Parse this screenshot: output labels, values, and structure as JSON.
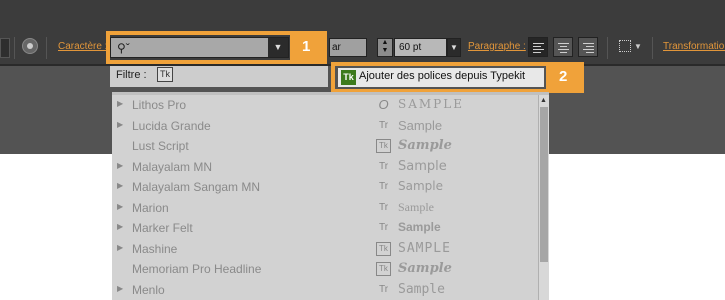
{
  "toolbar": {
    "character_label": "Caractère :",
    "font_search_placeholder": "",
    "style_value": "ar",
    "size_value": "60 pt",
    "paragraph_label": "Paragraphe :",
    "transform_label": "Transformation"
  },
  "callouts": {
    "one": "1",
    "two": "2"
  },
  "filter": {
    "label": "Filtre :",
    "typekit_icon": "Tk"
  },
  "typekit_button": {
    "icon": "Tk",
    "label": "Ajouter des polices depuis Typekit"
  },
  "font_list": [
    {
      "name": "Lithos Pro",
      "expandable": true,
      "type_icon": "O",
      "type": "opentype-icon",
      "sample": "SAMPLE"
    },
    {
      "name": "Lucida Grande",
      "expandable": true,
      "type_icon": "Tr",
      "type": "truetype-icon",
      "sample": "Sample"
    },
    {
      "name": "Lust Script",
      "expandable": false,
      "type_icon": "Tk",
      "type": "typekit-icon",
      "sample": "Sample"
    },
    {
      "name": "Malayalam MN",
      "expandable": true,
      "type_icon": "Tr",
      "type": "truetype-icon",
      "sample": "Sample"
    },
    {
      "name": "Malayalam Sangam MN",
      "expandable": true,
      "type_icon": "Tr",
      "type": "truetype-icon",
      "sample": "Sample"
    },
    {
      "name": "Marion",
      "expandable": true,
      "type_icon": "Tr",
      "type": "truetype-icon",
      "sample": "Sample"
    },
    {
      "name": "Marker Felt",
      "expandable": true,
      "type_icon": "Tr",
      "type": "truetype-icon",
      "sample": "Sample"
    },
    {
      "name": "Mashine",
      "expandable": true,
      "type_icon": "Tk",
      "type": "typekit-icon",
      "sample": "SAMPLE"
    },
    {
      "name": "Memoriam Pro Headline",
      "expandable": false,
      "type_icon": "Tk",
      "type": "typekit-icon",
      "sample": "Sample"
    },
    {
      "name": "Menlo",
      "expandable": true,
      "type_icon": "Tr",
      "type": "truetype-icon",
      "sample": "Sample"
    }
  ],
  "colors": {
    "accent": "#f0a23a",
    "toolbar_bg": "#3c3c3c",
    "label": "#e2963a"
  }
}
